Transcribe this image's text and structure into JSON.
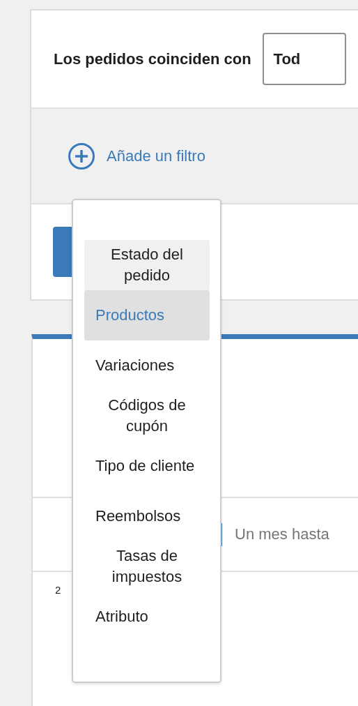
{
  "filter_card": {
    "title": "Los pedidos coinciden con",
    "match_select": {
      "value": "Tod"
    },
    "add_filter": {
      "label": "Añade un filtro"
    }
  },
  "filter_menu": {
    "items": [
      {
        "label": "Estado del pedido",
        "selected": false,
        "hovered": true
      },
      {
        "label": "Productos",
        "selected": true,
        "hovered": false
      },
      {
        "label": "Variaciones",
        "selected": false,
        "hovered": false
      },
      {
        "label": "Códigos de cupón",
        "selected": false,
        "hovered": false
      },
      {
        "label": "Tipo de cliente",
        "selected": false,
        "hovered": false
      },
      {
        "label": "Reembolsos",
        "selected": false,
        "hovered": false
      },
      {
        "label": "Tasas de impuestos",
        "selected": false,
        "hovered": false
      },
      {
        "label": "Atributo",
        "selected": false,
        "hovered": false
      }
    ]
  },
  "report_card": {
    "date_range": "Un mes hasta",
    "chart_tick": "2"
  }
}
